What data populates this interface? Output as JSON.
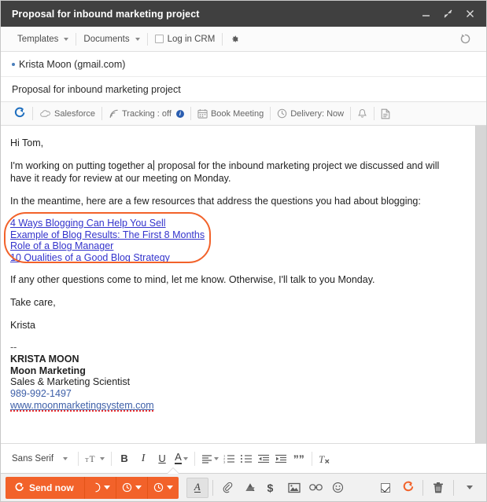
{
  "window": {
    "title": "Proposal for inbound marketing project",
    "minimize_label": "minimize",
    "popout_label": "pop out",
    "close_label": "close"
  },
  "app_toolbar": {
    "templates": "Templates",
    "documents": "Documents",
    "log_in_crm": "Log in CRM",
    "settings_label": "Settings",
    "refresh_label": "Refresh"
  },
  "compose": {
    "recipient": "Krista Moon (gmail.com)",
    "subject": "Proposal for inbound marketing project"
  },
  "sales_toolbar": {
    "sprocket_label": "HubSpot",
    "salesforce": "Salesforce",
    "tracking": "Tracking : off",
    "tracking_info": "i",
    "book_meeting": "Book Meeting",
    "delivery": "Delivery: Now",
    "notify_label": "Notifications",
    "document_label": "Documents"
  },
  "email_body": {
    "greeting": "Hi Tom,",
    "para1_before_caret": "I'm working on putting together a",
    "para1_after_caret": " proposal for the inbound marketing project we discussed and will have it ready for review at our meeting on Monday.",
    "para2": "In the meantime, here are a few resources that address the questions you had about blogging:",
    "links": [
      "4 Ways Blogging Can Help You Sell",
      "Example of Blog Results: The First 8 Months",
      "Role of a Blog Manager",
      "10 Qualities of a Good Blog Strategy"
    ],
    "para3": "If any other questions come to mind, let me know. Otherwise, I'll talk to you Monday.",
    "closing": "Take care,",
    "signoff_name": "Krista",
    "signature": {
      "separator": "--",
      "name": "KRISTA MOON",
      "company": "Moon Marketing",
      "title": "Sales & Marketing Scientist",
      "phone": "989-992-1497",
      "website": "www.moonmarketingsystem.com"
    }
  },
  "format_toolbar": {
    "font": "Sans Serif",
    "font_size_label": "Size",
    "bold": "B",
    "italic": "I",
    "underline": "U",
    "text_color": "A",
    "align_label": "Align",
    "numbered_list_label": "Numbered list",
    "bulleted_list_label": "Bulleted list",
    "indent_less_label": "Indent less",
    "indent_more_label": "Indent more",
    "quote": "””",
    "remove_formatting_label": "Remove formatting"
  },
  "action_bar": {
    "send_now": "Send now",
    "send_later_label": "Send later",
    "schedule_label": "Schedule",
    "schedule_alt_label": "Schedule options",
    "formatting_label": "A",
    "attach_label": "Attach files",
    "drive_label": "Insert from Drive",
    "money_label": "Insert payment",
    "photo_label": "Insert photo",
    "link_label": "Insert link",
    "emoji_label": "Insert emoji",
    "track_checkbox_label": "Track",
    "hubspot_label": "HubSpot",
    "trash_label": "Discard draft",
    "more_label": "More options"
  },
  "colors": {
    "accent_orange": "#f2622a",
    "titlebar": "#404040",
    "link_blue": "#3333cc",
    "sig_blue": "#3d5fa8",
    "annotation": "#f2622a"
  }
}
